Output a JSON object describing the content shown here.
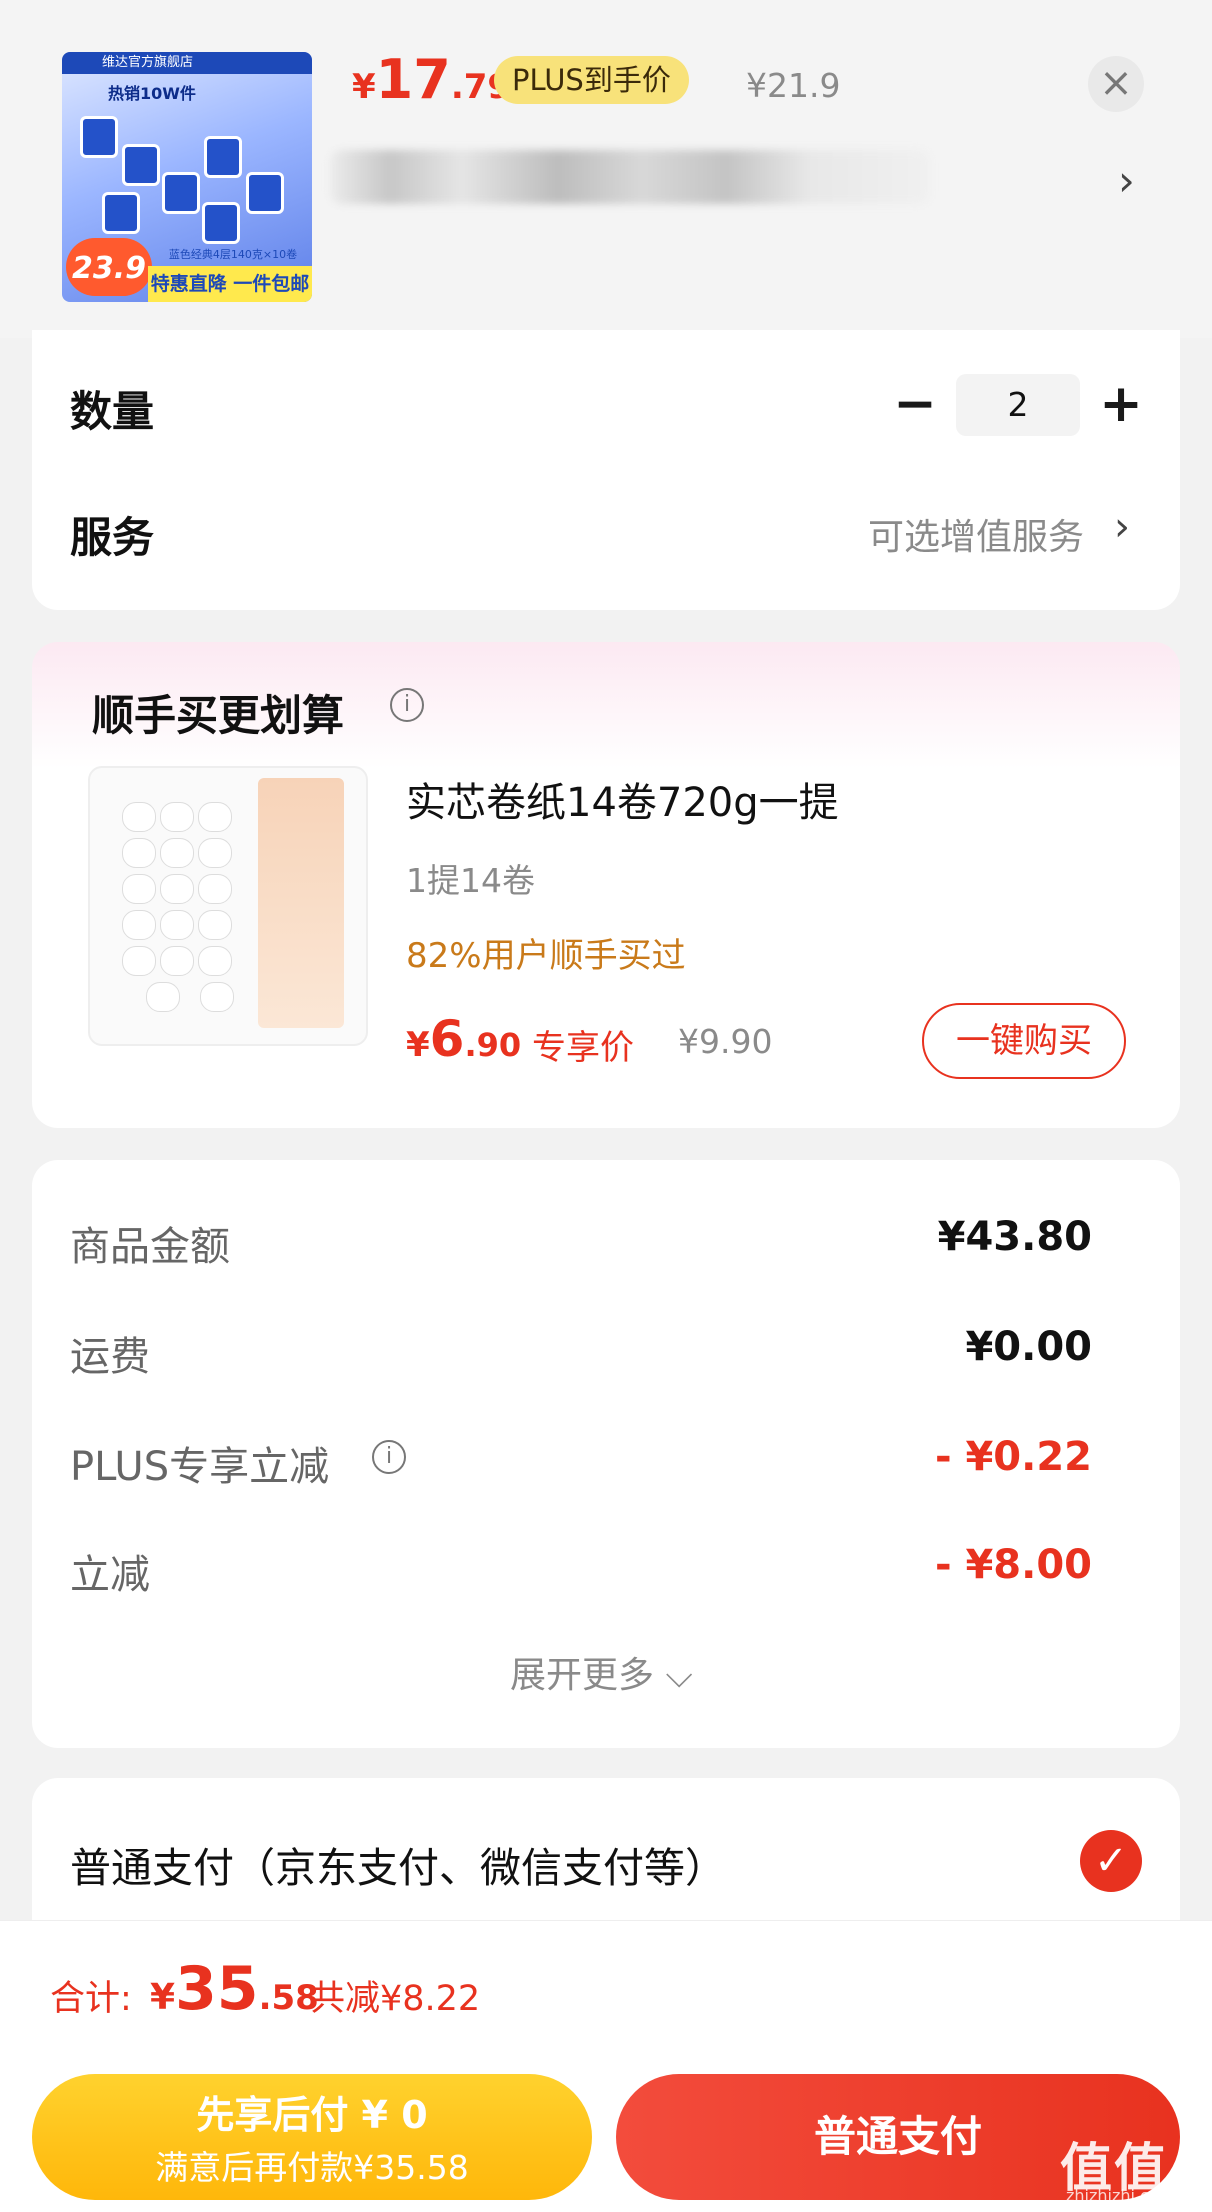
{
  "product": {
    "thumb": {
      "shop": "维达官方旗舰店",
      "hot": "热销10W件",
      "badge_price": "23.9",
      "promo": "特惠直降 一件包邮",
      "spec": "蓝色经典4层140克×10卷"
    },
    "price_symbol": "¥",
    "price_int": "17",
    "price_dec": ".79",
    "plus_badge": "PLUS到手价",
    "original_price": "¥21.9",
    "close_icon": "close-icon"
  },
  "quantity": {
    "label": "数量",
    "minus": "−",
    "value": "2",
    "plus": "+"
  },
  "service": {
    "label": "服务",
    "value": "可选增值服务",
    "chevron": "›"
  },
  "addon": {
    "title": "顺手买更划算",
    "info_icon": "i",
    "name": "实芯卷纸14卷720g一提",
    "spec": "1提14卷",
    "popularity": "82%用户顺手买过",
    "price_symbol": "¥",
    "price_int": "6",
    "price_dec": ".90",
    "exclusive": "专享价",
    "original_price": "¥9.90",
    "buy_label": "一键购买"
  },
  "summary": {
    "rows": [
      {
        "label": "商品金额",
        "value": "¥43.80"
      },
      {
        "label": "运费",
        "value": "¥0.00"
      },
      {
        "label": "PLUS专享立减",
        "value": "- ¥0.22"
      },
      {
        "label": "立减",
        "value": "- ¥8.00"
      }
    ],
    "expand": "展开更多 ⌵"
  },
  "payment": {
    "label": "普通支付（京东支付、微信支付等）",
    "check": "✓"
  },
  "footer": {
    "total_label": "合计:",
    "total_symbol": "¥",
    "total_int": "35",
    "total_dec": ".58",
    "saved": "共减¥8.22",
    "later_line1": "先享后付 ¥ 0",
    "later_line2": "满意后再付款¥35.58",
    "normal_pay": "普通支付"
  },
  "watermark": {
    "text": "值值值",
    "sub": "zhizhizhi.com"
  },
  "colors": {
    "accent_red": "#e8321f",
    "plus_gold": "#f8e27a",
    "later_yellow": "#ffc21a"
  }
}
